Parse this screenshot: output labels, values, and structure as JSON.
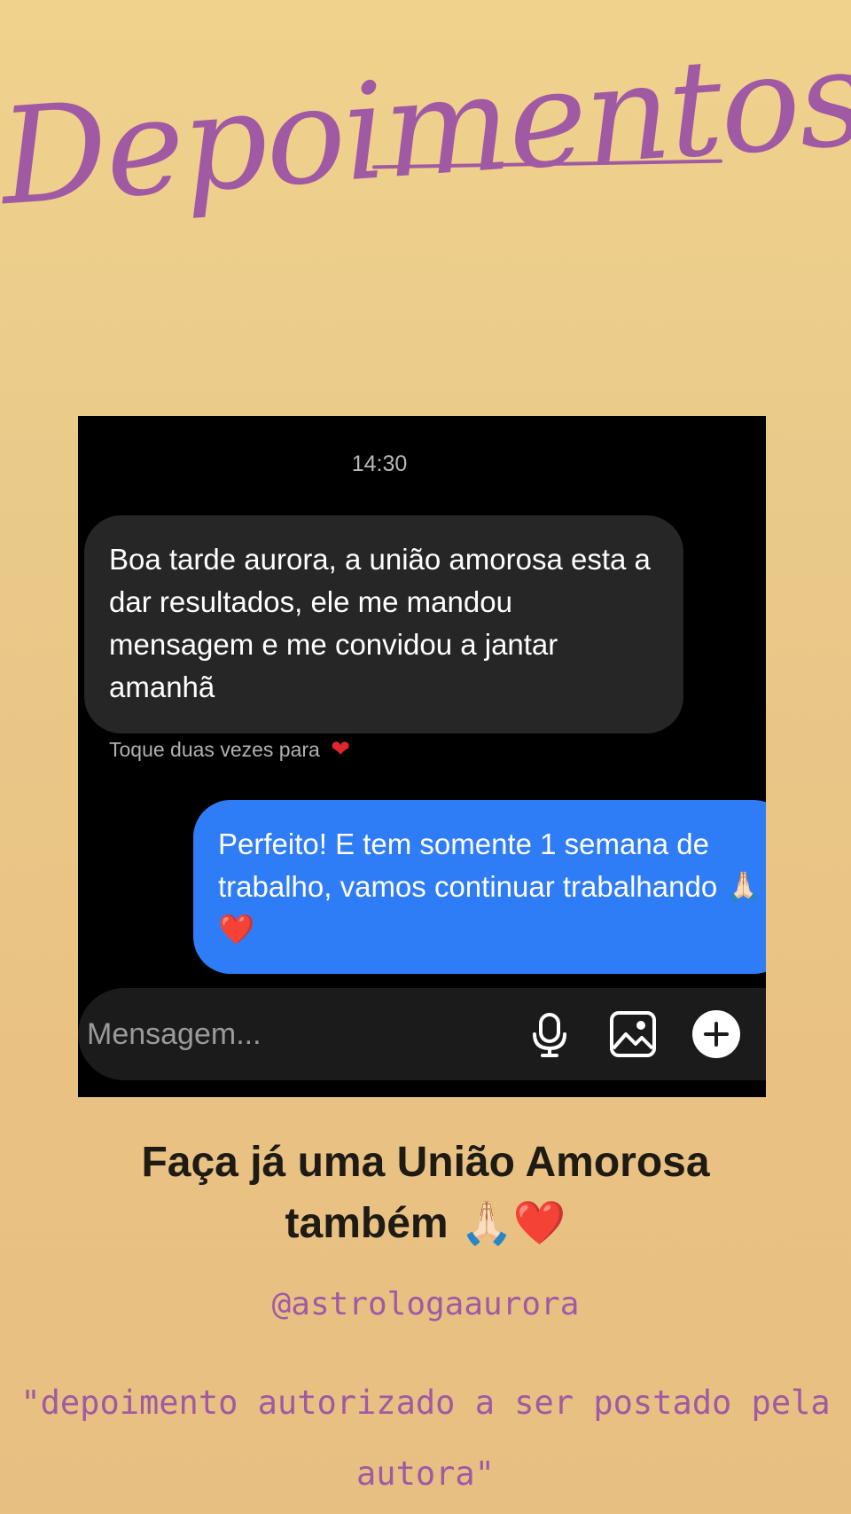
{
  "page": {
    "headline": "Depoimentos",
    "accent_color": "#a05aa4",
    "background_colors": [
      "#f0d28c",
      "#e7bf82"
    ]
  },
  "chat": {
    "timestamp": "14:30",
    "incoming_message": "Boa tarde aurora, a união amorosa esta a dar resultados, ele me mandou mensagem e me convidou a jantar amanhã",
    "hint_text": "Toque duas vezes para",
    "hint_icon": "heart",
    "outgoing_message": "Perfeito! E tem somente 1 semana de trabalho, vamos continuar trabalhando",
    "outgoing_emoji": "🙏🏻",
    "outgoing_heart": "❤️",
    "outgoing_bubble_color": "#2f7cf7",
    "incoming_bubble_color": "#262626",
    "composer": {
      "placeholder": "Mensagem...",
      "icons": [
        "microphone-icon",
        "image-icon",
        "plus-icon"
      ]
    }
  },
  "cta": {
    "line1": "Faça já uma União Amorosa",
    "line2": "também",
    "emoji": "🙏🏻",
    "heart": "❤️"
  },
  "footer": {
    "handle": "@astrologaaurora",
    "note": "\"depoimento autorizado a ser postado pela autora\""
  }
}
